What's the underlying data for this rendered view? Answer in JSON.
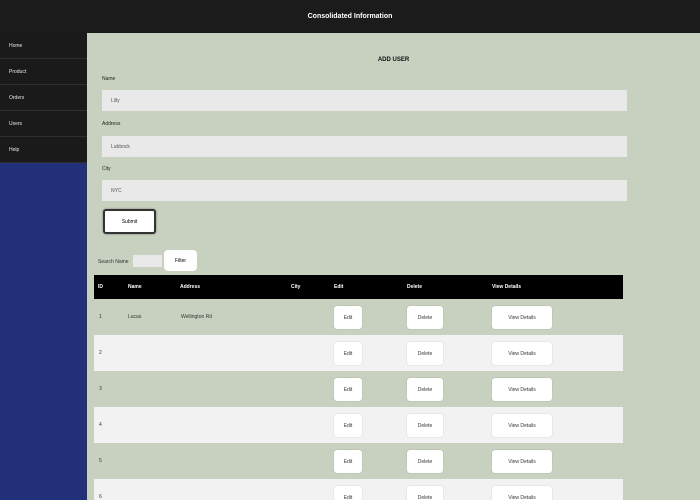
{
  "app": {
    "title": "Consolidated Information"
  },
  "sidebar": {
    "items": [
      {
        "label": "Home"
      },
      {
        "label": "Product"
      },
      {
        "label": "Orders"
      },
      {
        "label": "Users"
      },
      {
        "label": "Help"
      }
    ]
  },
  "main": {
    "title": "ADD USER"
  },
  "form": {
    "name_label": "Name",
    "name_value": "Lilly",
    "address_label": "Address",
    "address_value": "Lubbock",
    "city_label": "City",
    "city_value": "NYC",
    "submit_label": "Submit"
  },
  "filter": {
    "label": "Search Name",
    "button_label": "Filter"
  },
  "table": {
    "columns": {
      "id": "ID",
      "name": "Name",
      "address": "Address",
      "city": "City",
      "edit": "Edit",
      "delete": "Delete",
      "details": "View Details"
    },
    "rows": [
      {
        "id": "1",
        "name": "Lucas",
        "address": "Wellington Rd",
        "city": "",
        "edit": "Edit",
        "delete": "Delete",
        "details": "View Details"
      },
      {
        "id": "2",
        "name": "",
        "address": "",
        "city": "",
        "edit": "Edit",
        "delete": "Delete",
        "details": "View Details"
      },
      {
        "id": "3",
        "name": "",
        "address": "",
        "city": "",
        "edit": "Edit",
        "delete": "Delete",
        "details": "View Details"
      },
      {
        "id": "4",
        "name": "",
        "address": "",
        "city": "",
        "edit": "Edit",
        "delete": "Delete",
        "details": "View Details"
      },
      {
        "id": "5",
        "name": "",
        "address": "",
        "city": "",
        "edit": "Edit",
        "delete": "Delete",
        "details": "View Details"
      },
      {
        "id": "6",
        "name": "",
        "address": "",
        "city": "",
        "edit": "Edit",
        "delete": "Delete",
        "details": "View Details"
      }
    ]
  }
}
